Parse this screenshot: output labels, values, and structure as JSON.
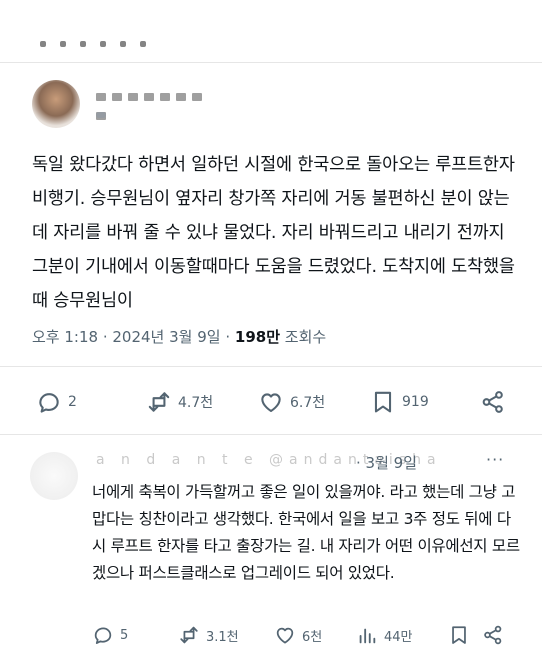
{
  "main_tweet": {
    "text": "독일 왔다갔다 하면서 일하던 시절에 한국으로 돌아오는 루프트한자 비행기. 승무원님이 옆자리 창가쪽 자리에 거동 불편하신 분이 앉는데 자리를 바꿔 줄 수 있냐 물었다. 자리 바꿔드리고 내리기 전까지 그분이 기내에서 이동할때마다 도움을 드렸었다. 도착지에 도착했을때 승무원님이",
    "time": "오후 1:18",
    "sep1": " · ",
    "date": "2024년 3월 9일",
    "sep2": " · ",
    "views": "198만",
    "views_label": "조회수",
    "stats": {
      "replies": "2",
      "reposts": "4.7천",
      "likes": "6.7천",
      "bookmarks": "919"
    }
  },
  "reply": {
    "author_obscured": "a n d a n t e @andantaisha",
    "date": "· 3월 9일",
    "more": "···",
    "text": "너에게 축복이 가득할꺼고 좋은 일이 있을꺼야. 라고 했는데 그냥 고맙다는 칭찬이라고 생각했다. 한국에서 일을 보고 3주 정도 뒤에 다시 루프트 한자를 타고 출장가는 길. 내 자리가 어떤 이유에선지 모르겠으나 퍼스트클래스로 업그레이드 되어 있었다.",
    "stats": {
      "replies": "5",
      "reposts": "3.1천",
      "likes": "6천",
      "views": "44만"
    }
  },
  "colors": {
    "text": "#0f1419",
    "secondary": "#536471",
    "divider": "#e6e6e6"
  },
  "icons": [
    "reply-icon",
    "repost-icon",
    "like-icon",
    "bookmark-icon",
    "share-icon",
    "views-icon",
    "more-icon"
  ]
}
